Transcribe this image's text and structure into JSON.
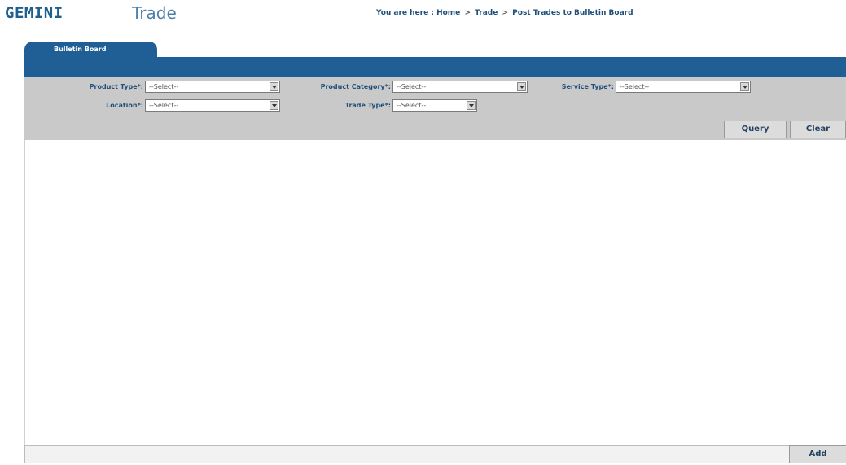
{
  "header": {
    "brand": "GEMINI",
    "module": "Trade",
    "breadcrumb": {
      "prefix": "You are here :",
      "items": [
        "Home",
        "Trade",
        "Post Trades to Bulletin Board"
      ],
      "separator": ">"
    }
  },
  "tab": {
    "label": "Bulletin Board"
  },
  "filters": {
    "product_type": {
      "label": "Product Type*:",
      "value": "--Select--"
    },
    "product_category": {
      "label": "Product Category*:",
      "value": "--Select--"
    },
    "service_type": {
      "label": "Service Type*:",
      "value": "--Select--"
    },
    "location": {
      "label": "Location*:",
      "value": "--Select--"
    },
    "trade_type": {
      "label": "Trade Type*:",
      "value": "--Select--"
    }
  },
  "actions": {
    "query_label": "Query",
    "clear_label": "Clear",
    "add_label": "Add"
  },
  "colors": {
    "brand": "#1f5f8e",
    "tab_bar": "#1f5f95",
    "filter_bg": "#c9c9c9"
  }
}
